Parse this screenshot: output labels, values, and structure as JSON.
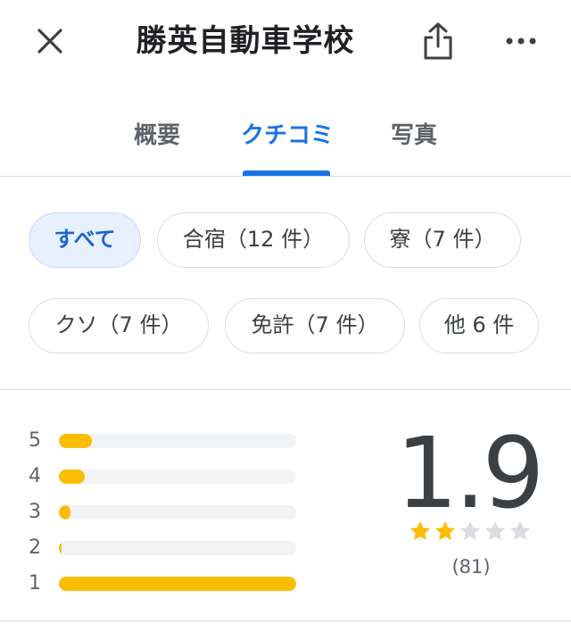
{
  "header": {
    "title": "勝英自動車学校",
    "close_icon": "close-icon",
    "share_icon": "share-icon",
    "more_icon": "more-horiz-icon"
  },
  "tabs": [
    {
      "label": "概要",
      "active": false
    },
    {
      "label": "クチコミ",
      "active": true
    },
    {
      "label": "写真",
      "active": false
    }
  ],
  "filters": [
    {
      "label": "すべて",
      "selected": true
    },
    {
      "label": "合宿（12 件）",
      "selected": false
    },
    {
      "label": "寮（7 件）",
      "selected": false
    },
    {
      "label": "クソ（7 件）",
      "selected": false
    },
    {
      "label": "免許（7 件）",
      "selected": false
    },
    {
      "label": "他 6 件",
      "selected": false
    }
  ],
  "rating": {
    "average": "1.9",
    "count": "(81)",
    "stars_filled": 2,
    "stars_total": 5,
    "distribution": [
      {
        "star": "5",
        "fraction": 0.14
      },
      {
        "star": "4",
        "fraction": 0.11
      },
      {
        "star": "3",
        "fraction": 0.05
      },
      {
        "star": "2",
        "fraction": 0.01
      },
      {
        "star": "1",
        "fraction": 1.0
      }
    ]
  },
  "colors": {
    "accent": "#1a73e8",
    "star_filled": "#fbbc04",
    "star_empty": "#dadce0",
    "chip_selected_bg": "#e8f0fe"
  }
}
